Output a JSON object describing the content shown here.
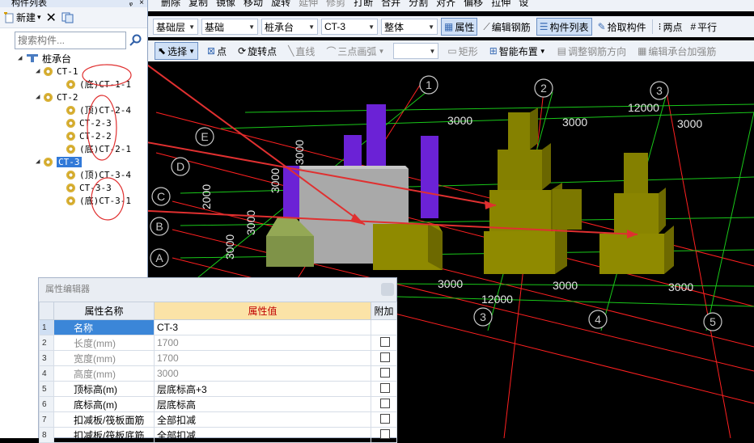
{
  "left_panel": {
    "title": "构件列表",
    "toolbar": {
      "new_label": "新建",
      "new_arrow": "▾"
    },
    "search": {
      "placeholder": "搜索构件..."
    },
    "tree": {
      "root": "桩承台",
      "groups": [
        {
          "label": "CT-1",
          "children": [
            "(底)CT-1-1"
          ]
        },
        {
          "label": "CT-2",
          "children": [
            "(顶)CT-2-4",
            "CT-2-3",
            "CT-2-2",
            "(底)CT-2-1"
          ]
        },
        {
          "label": "CT-3",
          "children": [
            "(顶)CT-3-4",
            "CT-3-3",
            "(底)CT-3-1"
          ]
        }
      ]
    }
  },
  "toolbar1": {
    "items": [
      "删除",
      "复制",
      "镜像",
      "移动",
      "旋转",
      "延伸",
      "修剪",
      "打断",
      "合并",
      "分割",
      "对齐",
      "偏移",
      "拉伸",
      "设"
    ]
  },
  "toolbar2": {
    "floor": "基础层",
    "category": "基础",
    "type": "桩承台",
    "component": "CT-3",
    "mode": "整体",
    "properties": "属性",
    "edit_rebar": "编辑钢筋",
    "component_list": "构件列表",
    "pick": "拾取构件",
    "two_points": "两点",
    "parallel": "平行"
  },
  "toolbar3": {
    "select": "选择",
    "point": "点",
    "rotate_point": "旋转点",
    "line": "直线",
    "arc": "三点画弧",
    "rect": "矩形",
    "smart_layout": "智能布置",
    "adjust_rebar": "调整钢筋方向",
    "edit_cap_rebar": "编辑承台加强筋"
  },
  "grid": {
    "col_labels": [
      "1",
      "2",
      "3",
      "4",
      "5",
      "3"
    ],
    "row_labels": [
      "E",
      "D",
      "C",
      "B",
      "A"
    ],
    "dims_top": [
      "12000",
      "3000",
      "3000",
      "3000"
    ],
    "dims_bottom": [
      "3000",
      "3000",
      "3000",
      "12000"
    ],
    "dims_left": [
      "2000",
      "3000",
      "3000",
      "3000",
      "3000"
    ]
  },
  "property_editor": {
    "title": "属性编辑器",
    "headers": [
      "属性名称",
      "属性值",
      "附加"
    ],
    "rows": [
      {
        "n": "1",
        "name": "名称",
        "value": "CT-3",
        "check": false
      },
      {
        "n": "2",
        "name": "长度(mm)",
        "value": "1700",
        "check": true
      },
      {
        "n": "3",
        "name": "宽度(mm)",
        "value": "1700",
        "check": true
      },
      {
        "n": "4",
        "name": "高度(mm)",
        "value": "3000",
        "check": true
      },
      {
        "n": "5",
        "name": "顶标高(m)",
        "value": "层底标高+3",
        "check": true
      },
      {
        "n": "6",
        "name": "底标高(m)",
        "value": "层底标高",
        "check": true
      },
      {
        "n": "7",
        "name": "扣减板/筏板面筋",
        "value": "全部扣减",
        "check": true
      },
      {
        "n": "8",
        "name": "扣减板/筏板底筋",
        "value": "全部扣减",
        "check": true
      }
    ]
  },
  "colors": {
    "accent": "#3179d8",
    "annotation": "#e03030",
    "grid_red": "#ff2020",
    "grid_green": "#19c819",
    "cap_olive": "#8f8a00",
    "column_purple": "#6b22d6"
  }
}
